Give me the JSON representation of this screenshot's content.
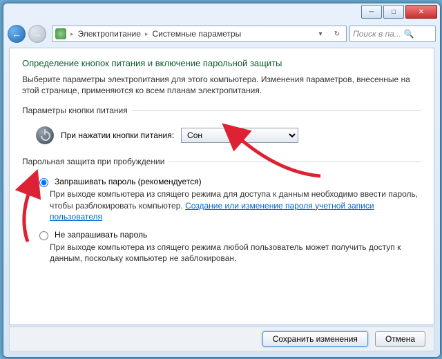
{
  "breadcrumb": {
    "item1": "Электропитание",
    "item2": "Системные параметры"
  },
  "search": {
    "placeholder": "Поиск в па..."
  },
  "page": {
    "title": "Определение кнопок питания и включение парольной защиты",
    "intro": "Выберите параметры электропитания для этого компьютера. Изменения параметров, внесенные на этой странице, применяются ко всем планам электропитания."
  },
  "group_power": {
    "legend": "Параметры кнопки питания",
    "label": "При нажатии кнопки питания:",
    "value": "Сон"
  },
  "group_password": {
    "legend": "Парольная защита при пробуждении",
    "opt1_label": "Запрашивать пароль (рекомендуется)",
    "opt1_desc_before": "При выходе компьютера из спящего режима для доступа к данным необходимо ввести пароль, чтобы разблокировать компьютер. ",
    "opt1_link": "Создание или изменение пароля учетной записи пользователя",
    "opt2_label": "Не запрашивать пароль",
    "opt2_desc": "При выходе компьютера из спящего режима любой пользователь может получить доступ к данным, поскольку компьютер не заблокирован."
  },
  "footer": {
    "save": "Сохранить изменения",
    "cancel": "Отмена"
  }
}
